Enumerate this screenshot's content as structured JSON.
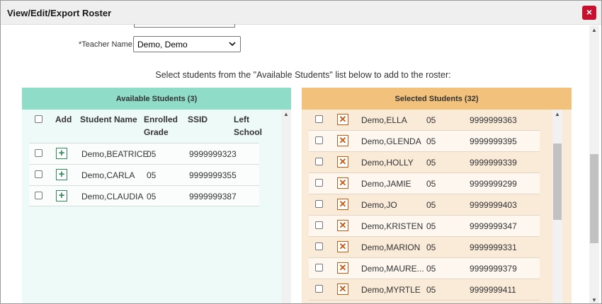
{
  "dialog": {
    "title": "View/Edit/Export Roster",
    "close_icon": "×"
  },
  "teacher": {
    "label": "*Teacher Name:",
    "selected": "Demo, Demo"
  },
  "instruction": "Select students from the \"Available Students\" list below to add to the roster:",
  "available": {
    "header": "Available Students (3)",
    "columns": {
      "add": "Add",
      "name": "Student Name",
      "grade_line1": "Enrolled",
      "grade_line2": "Grade",
      "ssid": "SSID",
      "left_line1": "Left",
      "left_line2": "School"
    },
    "rows": [
      {
        "name": "Demo,BEATRICE",
        "grade": "05",
        "ssid": "9999999323"
      },
      {
        "name": "Demo,CARLA",
        "grade": "05",
        "ssid": "9999999355"
      },
      {
        "name": "Demo,CLAUDIA",
        "grade": "05",
        "ssid": "9999999387"
      }
    ]
  },
  "selected": {
    "header": "Selected Students (32)",
    "rows": [
      {
        "name": "Demo,ELLA",
        "grade": "05",
        "ssid": "9999999363"
      },
      {
        "name": "Demo,GLENDA",
        "grade": "05",
        "ssid": "9999999395"
      },
      {
        "name": "Demo,HOLLY",
        "grade": "05",
        "ssid": "9999999339"
      },
      {
        "name": "Demo,JAMIE",
        "grade": "05",
        "ssid": "9999999299"
      },
      {
        "name": "Demo,JO",
        "grade": "05",
        "ssid": "9999999403"
      },
      {
        "name": "Demo,KRISTEN",
        "grade": "05",
        "ssid": "9999999347"
      },
      {
        "name": "Demo,MARION",
        "grade": "05",
        "ssid": "9999999331"
      },
      {
        "name": "Demo,MAURE...",
        "grade": "05",
        "ssid": "9999999379"
      },
      {
        "name": "Demo,MYRTLE",
        "grade": "05",
        "ssid": "9999999411"
      }
    ]
  },
  "icons": {
    "add": "plus-icon",
    "remove": "remove-x-icon",
    "close": "close-icon",
    "dropdown": "chevron-down-icon"
  },
  "colors": {
    "available_header": "#8fdcc8",
    "selected_header": "#f2c27c",
    "close_button": "#c8102e",
    "add_icon": "#2e8b57",
    "remove_icon": "#c55a11"
  }
}
